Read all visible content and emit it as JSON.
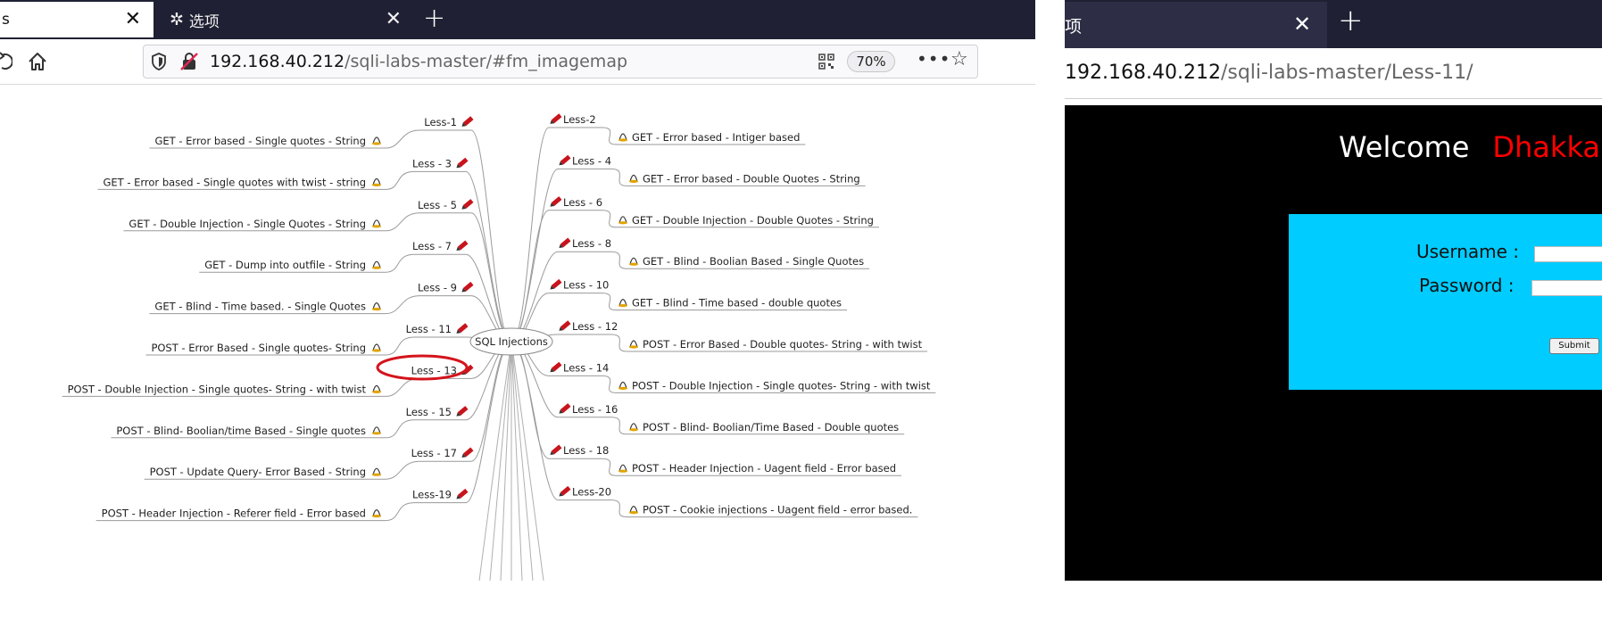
{
  "left_browser": {
    "tabs": [
      {
        "label": "s",
        "active": true
      },
      {
        "label": "选项",
        "active": false
      }
    ],
    "url_host": "192.168.40.212",
    "url_path": "/sqli-labs-master/#fm_imagemap",
    "zoom": "70%",
    "mindmap": {
      "center": "SQL Injections",
      "left_lessons": [
        {
          "less": "Less-1",
          "desc": "GET - Error based - Single quotes - String"
        },
        {
          "less": "Less - 3",
          "desc": "GET - Error based - Single quotes with twist - string"
        },
        {
          "less": "Less - 5",
          "desc": "GET - Double Injection - Single Quotes - String"
        },
        {
          "less": "Less - 7",
          "desc": "GET - Dump into outfile - String"
        },
        {
          "less": "Less - 9",
          "desc": "GET - Blind - Time based. -  Single Quotes"
        },
        {
          "less": "Less - 11",
          "desc": "POST - Error Based - Single quotes- String",
          "highlighted": true
        },
        {
          "less": "Less - 13",
          "desc": "POST - Double Injection - Single quotes- String - with twist"
        },
        {
          "less": "Less - 15",
          "desc": "POST - Blind- Boolian/time Based - Single quotes"
        },
        {
          "less": "Less - 17",
          "desc": "POST - Update Query- Error Based - String"
        },
        {
          "less": "Less-19",
          "desc": "POST - Header Injection - Referer field - Error based"
        }
      ],
      "right_lessons": [
        {
          "less": "Less-2",
          "desc": "GET - Error based - Intiger based"
        },
        {
          "less": "Less - 4",
          "desc": "GET - Error based - Double Quotes - String"
        },
        {
          "less": "Less - 6",
          "desc": "GET - Double Injection - Double Quotes - String"
        },
        {
          "less": "Less - 8",
          "desc": "GET - Blind - Boolian Based - Single Quotes"
        },
        {
          "less": "Less - 10",
          "desc": "GET - Blind - Time based - double quotes"
        },
        {
          "less": "Less - 12",
          "desc": "POST - Error Based - Double quotes- String - with twist"
        },
        {
          "less": "Less - 14",
          "desc": "POST - Double Injection - Single quotes- String - with twist"
        },
        {
          "less": "Less - 16",
          "desc": "POST - Blind- Boolian/Time Based - Double quotes"
        },
        {
          "less": "Less - 18",
          "desc": "POST - Header Injection - Uagent field - Error based"
        },
        {
          "less": "Less-20",
          "desc": "POST - Cookie injections - Uagent field - error based."
        }
      ]
    }
  },
  "right_browser": {
    "tab_label": "项",
    "url_host": "192.168.40.212",
    "url_path": "/sqli-labs-master/Less-11/",
    "welcome": "Welcome",
    "welcome_name": "Dhakkar",
    "username_label": "Username :",
    "password_label": "Password :",
    "submit_label": "Submit"
  }
}
